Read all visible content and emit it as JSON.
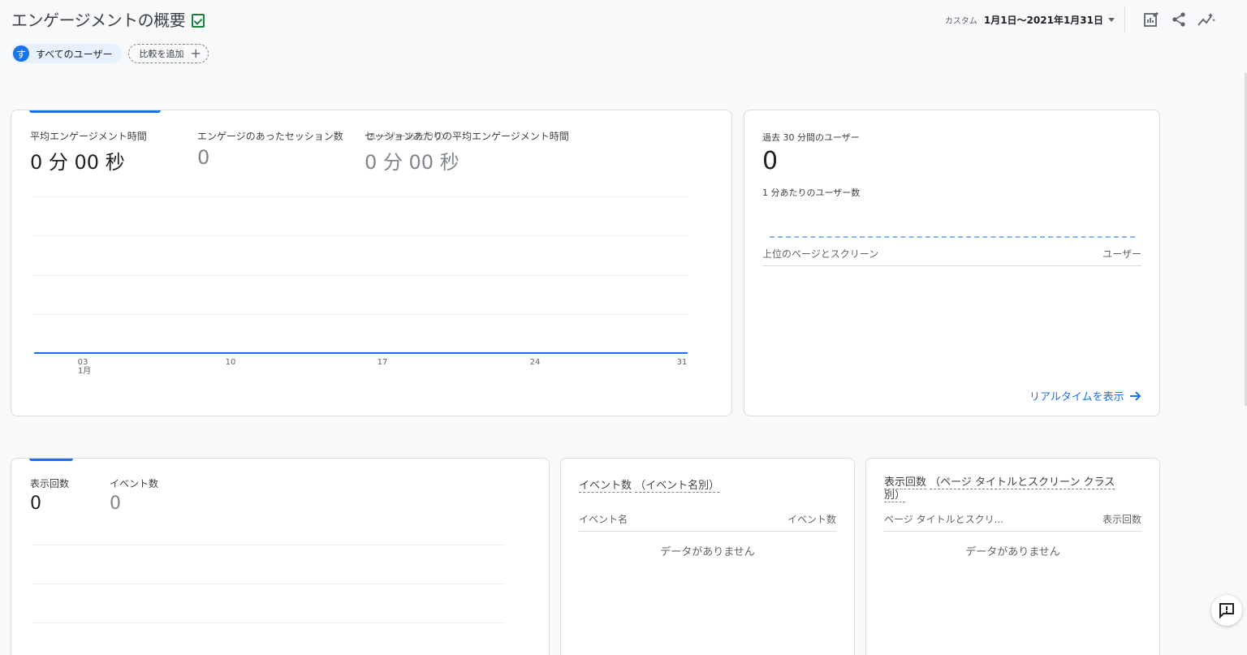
{
  "header": {
    "title": "エンゲージメントの概要",
    "date_label": "カスタム",
    "date_range": "1月1日～2021年1月31日",
    "icons": [
      "edit-report-icon",
      "share-icon",
      "insights-icon"
    ]
  },
  "filters": {
    "user_chip_initial": "す",
    "user_chip_label": "すべてのユーザー",
    "add_comparison_label": "比較を追加"
  },
  "engagement_card": {
    "metrics": [
      {
        "label": "平均エンゲージメント時間",
        "value": "0 分 00 秒"
      },
      {
        "label": "エンゲージのあったセッション数",
        "value": "0"
      },
      {
        "label": "セッションあたりの平均エンゲージメント時間",
        "value": "0 分 00 秒"
      }
    ],
    "overlap_label": "ユーザーあたりの",
    "x_ticks": [
      "03",
      "10",
      "17",
      "24",
      "31"
    ],
    "x_month": "1月"
  },
  "chart_data": {
    "type": "line",
    "x": [
      "03",
      "10",
      "17",
      "24",
      "31"
    ],
    "xlabel_sub": "1月",
    "series": [
      {
        "values": [
          0,
          0,
          0,
          0,
          0
        ]
      }
    ]
  },
  "realtime_card": {
    "label": "過去 30 分間のユーザー",
    "value": "0",
    "per_minute_label": "1 分あたりのユーザー数",
    "table_col1": "上位のページとスクリーン",
    "table_col2": "ユーザー",
    "link_label": "リアルタイムを表示"
  },
  "views_card": {
    "metrics": [
      {
        "label": "表示回数",
        "value": "0"
      },
      {
        "label": "イベント数",
        "value": "0"
      }
    ]
  },
  "events_card": {
    "title_a": "イベント数",
    "title_b": "（イベント名別）",
    "col1": "イベント名",
    "col2": "イベント数",
    "empty": "データがありません"
  },
  "pages_card": {
    "title_a": "表示回数",
    "title_b": "（ページ タイトルとスクリーン クラス",
    "title_c": "別）",
    "col1": "ページ タイトルとスクリ...",
    "col2": "表示回数",
    "empty": "データがありません"
  }
}
